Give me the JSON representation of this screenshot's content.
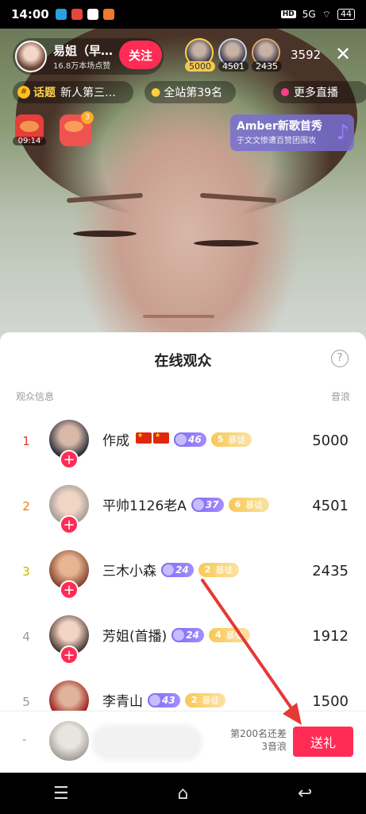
{
  "status_bar": {
    "time": "14:00",
    "network": "5G",
    "battery": "44"
  },
  "live": {
    "anchor_name": "易姐（早…",
    "anchor_likes": "16.8万本场点赞",
    "follow_label": "关注",
    "top_viewers": [
      {
        "value": "5000"
      },
      {
        "value": "4501"
      },
      {
        "value": "2435"
      }
    ],
    "viewer_count": "3592",
    "close_icon": "close-icon",
    "topic_label": "话题",
    "topic_text": "新人第三…",
    "rank_text": "全站第39名",
    "more_live": "更多直播",
    "gift1_timer": "09:14",
    "gift2_count": "3",
    "song_title": "Amber新歌首秀",
    "song_sub": "于文文惨遭百赞团围攻"
  },
  "sheet": {
    "title": "在线观众",
    "help_icon": "help-icon",
    "col_left": "观众信息",
    "col_right": "音浪",
    "rows": [
      {
        "rank": "1",
        "rank_color": "#e53935",
        "name": "作成",
        "flags": 2,
        "level": "46",
        "fan_level": "5",
        "fan_text": "暴徒",
        "score": "5000"
      },
      {
        "rank": "2",
        "rank_color": "#f57c00",
        "name": "平帅1126老A",
        "flags": 0,
        "level": "37",
        "fan_level": "6",
        "fan_text": "暴徒",
        "score": "4501"
      },
      {
        "rank": "3",
        "rank_color": "#c6b300",
        "name": "三木小森",
        "flags": 0,
        "level": "24",
        "fan_level": "2",
        "fan_text": "暴徒",
        "score": "2435"
      },
      {
        "rank": "4",
        "rank_color": "#999999",
        "name": "芳姐(首播)",
        "flags": 0,
        "level": "24",
        "fan_level": "4",
        "fan_text": "暴徒",
        "score": "1912"
      },
      {
        "rank": "5",
        "rank_color": "#999999",
        "name": "李青山",
        "flags": 0,
        "level": "43",
        "fan_level": "2",
        "fan_text": "暴徒",
        "score": "1500"
      }
    ]
  },
  "bottom_bar": {
    "rank_dash": "-",
    "gap_line1": "第200名还差",
    "gap_line2": "3音浪",
    "gift_button": "送礼"
  },
  "nav": {
    "menu_icon": "menu-icon",
    "home_icon": "home-icon",
    "back_icon": "back-icon"
  }
}
